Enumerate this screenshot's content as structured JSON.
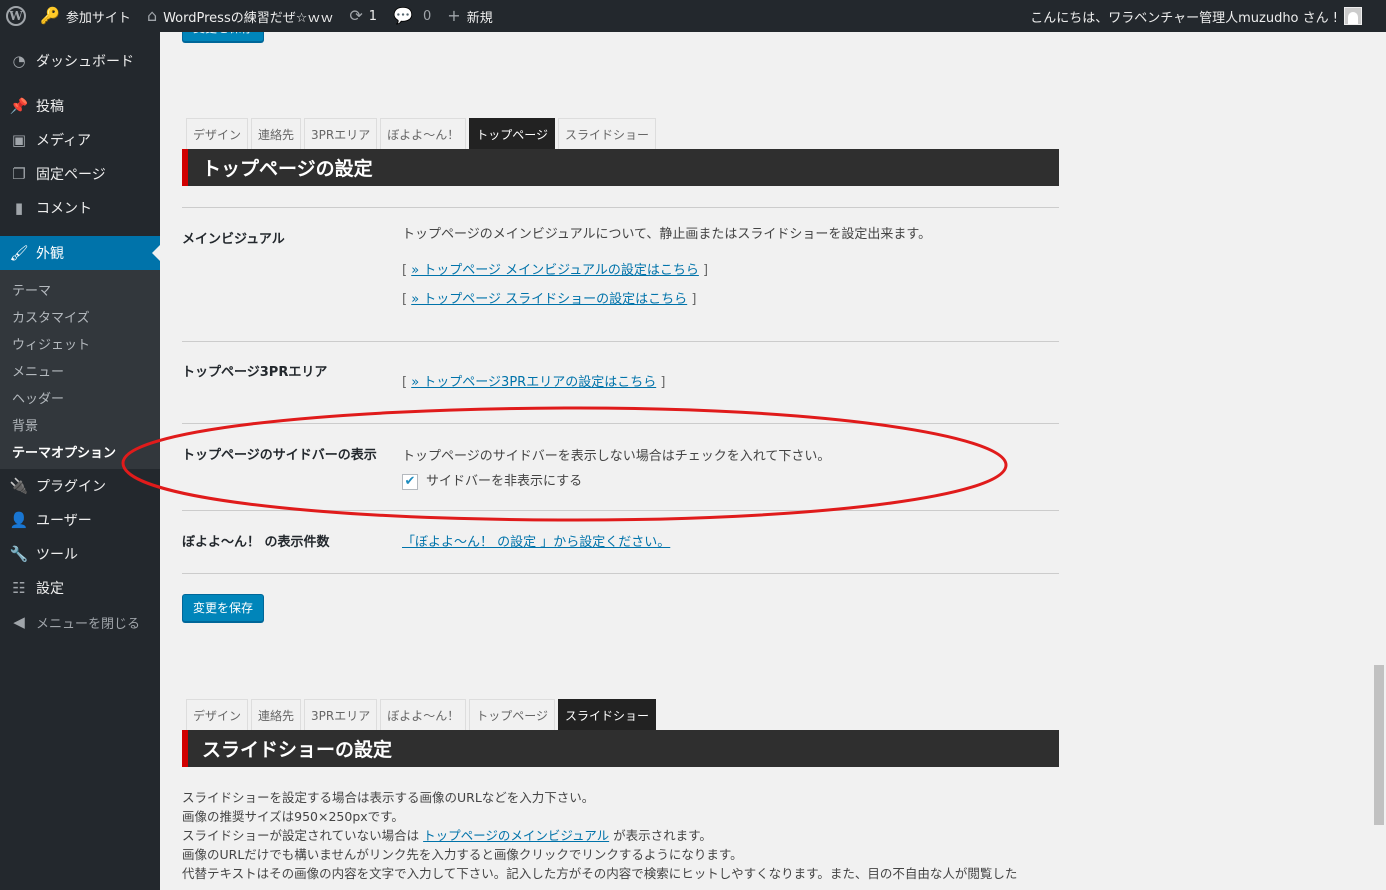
{
  "adminbar": {
    "site_link": "参加サイト",
    "site_name": "WordPressの練習だぜ☆ｗｗ",
    "updates_count": "1",
    "comments_count": "0",
    "new_label": "新規",
    "greeting": "こんにちは、ワラベンチャー管理人muzudho さん !"
  },
  "sidebar": {
    "items": [
      {
        "label": "ダッシュボード"
      },
      {
        "label": "投稿"
      },
      {
        "label": "メディア"
      },
      {
        "label": "固定ページ"
      },
      {
        "label": "コメント"
      },
      {
        "label": "外観"
      }
    ],
    "submenu": [
      "テーマ",
      "カスタマイズ",
      "ウィジェット",
      "メニュー",
      "ヘッダー",
      "背景",
      "テーマオプション"
    ],
    "items2": [
      {
        "label": "プラグイン"
      },
      {
        "label": "ユーザー"
      },
      {
        "label": "ツール"
      },
      {
        "label": "設定"
      }
    ],
    "collapse": "メニューを閉じる"
  },
  "save_button_top": "変更を保存",
  "tabs1": [
    "デザイン",
    "連絡先",
    "3PRエリア",
    "ぼよよ～ん！",
    "トップページ",
    "スライドショー"
  ],
  "section1_title": "トップページの設定",
  "rows": {
    "main_visual": {
      "label": "メインビジュアル",
      "desc": "トップページのメインビジュアルについて、静止画またはスライドショーを設定出来ます。",
      "link1": "» トップページ メインビジュアルの設定はこちら",
      "link2": "» トップページ スライドショーの設定はこちら"
    },
    "pr_area": {
      "label": "トップページ3PRエリア",
      "link": "» トップページ3PRエリアの設定はこちら"
    },
    "sidebar_display": {
      "label": "トップページのサイドバーの表示",
      "desc": "トップページのサイドバーを表示しない場合はチェックを入れて下さい。",
      "checkbox_label": "サイドバーを非表示にする"
    },
    "boyoyon_count": {
      "label": "ぼよよ～ん！ の表示件数",
      "link": "「ぼよよ～ん！ の設定 」から設定ください。"
    }
  },
  "bracket_open": "[",
  "bracket_close": "]",
  "save_button": "変更を保存",
  "tabs2": [
    "デザイン",
    "連絡先",
    "3PRエリア",
    "ぼよよ～ん！",
    "トップページ",
    "スライドショー"
  ],
  "section2_title": "スライドショーの設定",
  "slideshow_desc": {
    "line1": "スライドショーを設定する場合は表示する画像のURLなどを入力下さい。",
    "line2": "画像の推奨サイズは950×250pxです。",
    "line3_pre": "スライドショーが設定されていない場合は ",
    "line3_link": "トップページのメインビジュアル",
    "line3_post": " が表示されます。",
    "line4": "画像のURLだけでも構いませんがリンク先を入力すると画像クリックでリンクするようになります。",
    "line5": "代替テキストはその画像の内容を文字で入力して下さい。記入した方がその内容で検索にヒットしやすくなります。また、目の不自由な人が閲覧した"
  },
  "colors": {
    "adminbar_bg": "#23282d",
    "accent_blue": "#0073aa",
    "section_bar_bg": "#2f2f2f",
    "section_bar_accent": "#d10000",
    "annotation_red": "#e01b1b"
  }
}
